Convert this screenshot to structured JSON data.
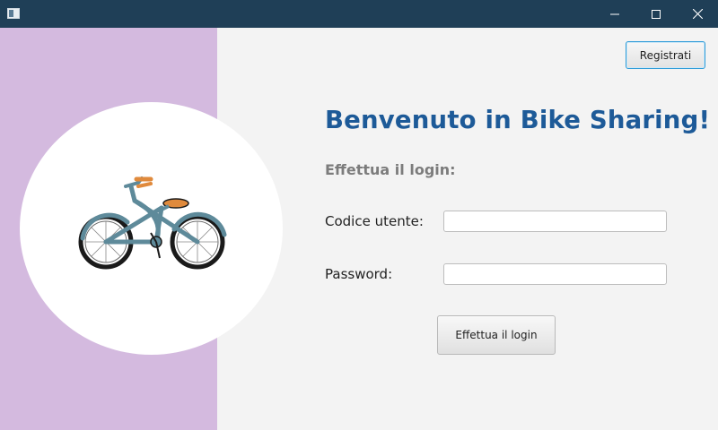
{
  "window": {
    "title": "",
    "controls": {
      "minimize_icon": "minimize-icon",
      "maximize_icon": "maximize-icon",
      "close_icon": "close-icon"
    },
    "titlebar_color": "#1f3f57"
  },
  "sidebar": {
    "background": "#d4badf",
    "illustration": "bicycle-icon"
  },
  "header": {
    "register_label": "Registrati"
  },
  "main": {
    "title": "Benvenuto in Bike Sharing!",
    "subtitle": "Effettua il login:",
    "fields": {
      "user_label": "Codice utente:",
      "user_value": "",
      "password_label": "Password:",
      "password_value": ""
    },
    "login_label": "Effettua il login"
  },
  "colors": {
    "title": "#1d5a98",
    "subtitle": "#7c7c7c",
    "accent_border": "#2d9bd8"
  }
}
